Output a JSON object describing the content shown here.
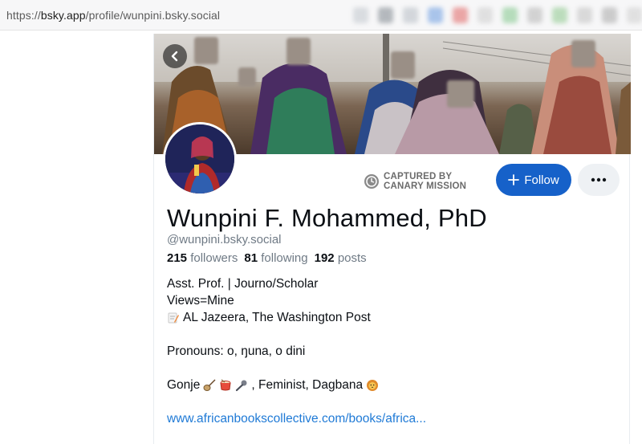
{
  "browser": {
    "url_scheme": "https://",
    "url_host": "bsky.app",
    "url_path": "/profile/wunpini.bsky.social"
  },
  "profile": {
    "display_name": "Wunpini F. Mohammed, PhD",
    "handle": "@wunpini.bsky.social",
    "followers_count": "215",
    "followers_label": "followers",
    "following_count": "81",
    "following_label": "following",
    "posts_count": "192",
    "posts_label": "posts",
    "follow_label": "Follow",
    "watermark_line1": "CAPTURED BY",
    "watermark_line2": "CANARY MISSION",
    "bio": {
      "line1": "Asst. Prof. | Journo/Scholar",
      "line2": "Views=Mine",
      "line3": "AL Jazeera, The Washington Post",
      "line4": "Pronouns: o, ŋuna, o dini",
      "line5_a": "Gonje",
      "line5_b": ", Feminist, Dagbana",
      "link": "www.africanbookscollective.com/books/africa..."
    }
  },
  "icons": {
    "back": "chevron-left-icon",
    "follow": "plus-icon",
    "more": "ellipsis-icon",
    "watermark": "clock-icon",
    "memo": "memo-icon",
    "instrument": "fiddle-icon",
    "drum": "drum-icon",
    "mic": "microphone-icon",
    "lion": "lion-icon"
  },
  "colors": {
    "accent": "#1661c9",
    "link": "#1f7ad6",
    "muted": "#6f7a85"
  }
}
